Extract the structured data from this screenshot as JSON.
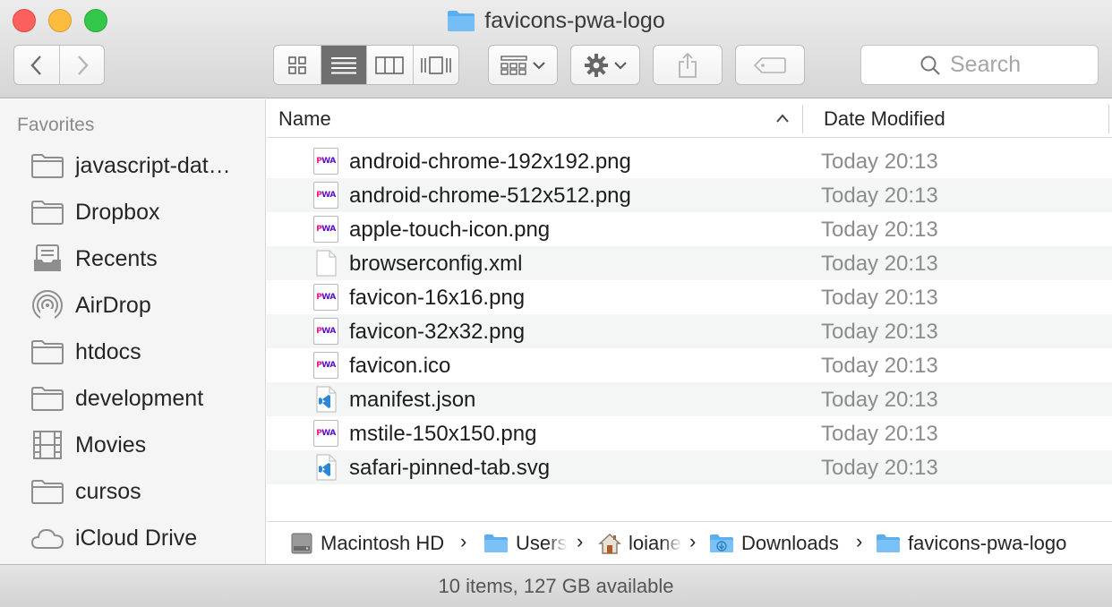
{
  "window": {
    "title": "favicons-pwa-logo"
  },
  "toolbar": {
    "back_icon": "chevron-left-icon",
    "forward_icon": "chevron-right-icon",
    "view_modes": [
      "icon-view",
      "list-view",
      "column-view",
      "cover-flow-view"
    ],
    "active_view": "list-view",
    "arrange_icon": "arrange-grid-icon",
    "action_icon": "gear-icon",
    "share_icon": "share-icon",
    "tag_icon": "tag-icon"
  },
  "search": {
    "placeholder": "Search"
  },
  "sidebar": {
    "header": "Favorites",
    "items": [
      {
        "label": "javascript-dat…",
        "icon": "folder-icon"
      },
      {
        "label": "Dropbox",
        "icon": "folder-icon"
      },
      {
        "label": "Recents",
        "icon": "recents-icon"
      },
      {
        "label": "AirDrop",
        "icon": "airdrop-icon"
      },
      {
        "label": "htdocs",
        "icon": "folder-icon"
      },
      {
        "label": "development",
        "icon": "folder-icon"
      },
      {
        "label": "Movies",
        "icon": "film-icon"
      },
      {
        "label": "cursos",
        "icon": "folder-icon"
      },
      {
        "label": "iCloud Drive",
        "icon": "cloud-icon"
      }
    ]
  },
  "columns": {
    "name": "Name",
    "date": "Date Modified"
  },
  "files": [
    {
      "name": "android-chrome-192x192.png",
      "date": "Today 20:13",
      "icon": "pwa-png-icon"
    },
    {
      "name": "android-chrome-512x512.png",
      "date": "Today 20:13",
      "icon": "pwa-png-icon"
    },
    {
      "name": "apple-touch-icon.png",
      "date": "Today 20:13",
      "icon": "pwa-png-icon"
    },
    {
      "name": "browserconfig.xml",
      "date": "Today 20:13",
      "icon": "blank-document-icon"
    },
    {
      "name": "favicon-16x16.png",
      "date": "Today 20:13",
      "icon": "pwa-png-icon"
    },
    {
      "name": "favicon-32x32.png",
      "date": "Today 20:13",
      "icon": "pwa-png-icon"
    },
    {
      "name": "favicon.ico",
      "date": "Today 20:13",
      "icon": "pwa-png-icon"
    },
    {
      "name": "manifest.json",
      "date": "Today 20:13",
      "icon": "vscode-document-icon"
    },
    {
      "name": "mstile-150x150.png",
      "date": "Today 20:13",
      "icon": "pwa-png-icon"
    },
    {
      "name": "safari-pinned-tab.svg",
      "date": "Today 20:13",
      "icon": "vscode-document-icon"
    }
  ],
  "pwa_badge": {
    "left": "P",
    "right": "WA"
  },
  "path": [
    {
      "label": "Macintosh HD",
      "icon": "hard-drive-icon"
    },
    {
      "label": "Users",
      "icon": "folder-icon"
    },
    {
      "label": "loiane",
      "icon": "home-icon"
    },
    {
      "label": "Downloads",
      "icon": "downloads-folder-icon"
    },
    {
      "label": "favicons-pwa-logo",
      "icon": "folder-icon"
    }
  ],
  "status": {
    "text": "10 items, 127 GB available"
  },
  "colors": {
    "close": "#fc605c",
    "minimize": "#fdbc40",
    "maximize": "#34c84a",
    "folder_blue": "#5aaef0",
    "pwa_purple": "#5a0fc8",
    "pwa_pink": "#e6168a"
  }
}
